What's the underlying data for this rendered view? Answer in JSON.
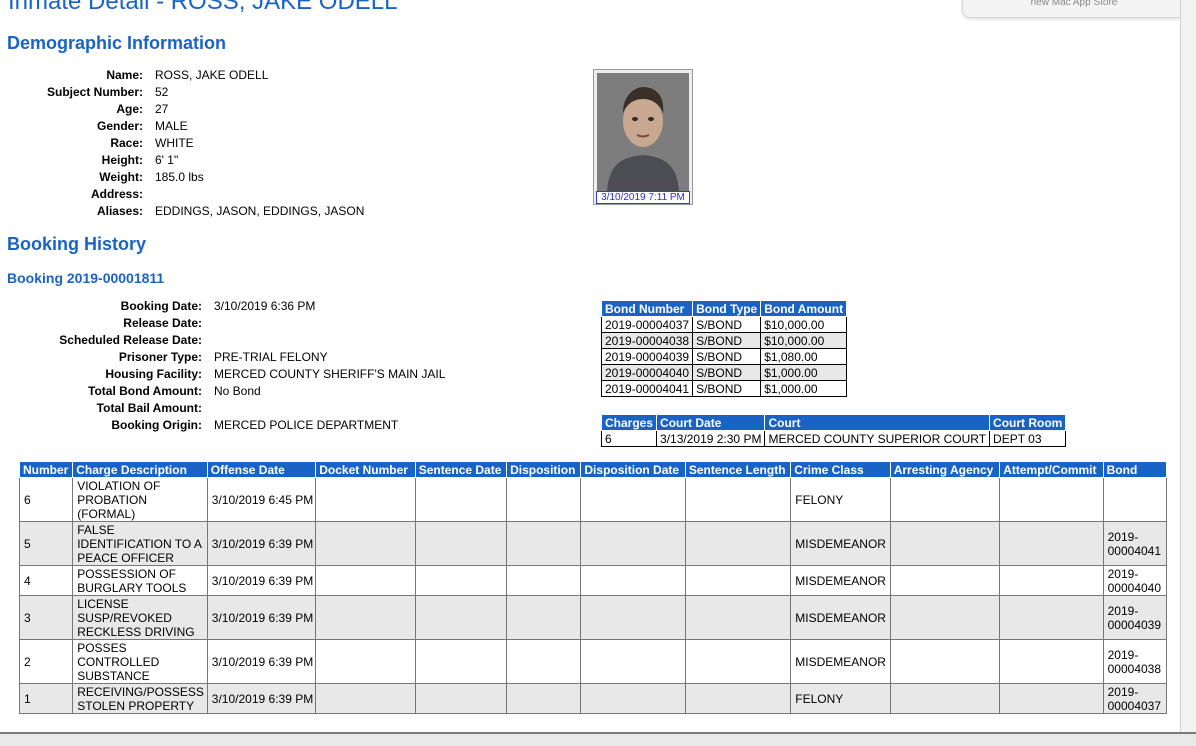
{
  "page": {
    "title": "Inmate Detail - ROSS, JAKE ODELL",
    "notification": "new Mac App Store"
  },
  "demographic": {
    "heading": "Demographic Information",
    "fields": [
      {
        "label": "Name:",
        "value": "ROSS, JAKE ODELL"
      },
      {
        "label": "Subject Number:",
        "value": "52"
      },
      {
        "label": "Age:",
        "value": "27"
      },
      {
        "label": "Gender:",
        "value": "MALE"
      },
      {
        "label": "Race:",
        "value": "WHITE"
      },
      {
        "label": "Height:",
        "value": "6' 1\""
      },
      {
        "label": "Weight:",
        "value": "185.0 lbs"
      },
      {
        "label": "Address:",
        "value": ""
      },
      {
        "label": "Aliases:",
        "value": "EDDINGS, JASON, EDDINGS, JASON"
      }
    ],
    "photo_caption": "3/10/2019 7:11 PM"
  },
  "booking_history": {
    "heading": "Booking History",
    "booking_title": "Booking 2019-00001811",
    "fields": [
      {
        "label": "Booking Date:",
        "value": "3/10/2019 6:36 PM"
      },
      {
        "label": "Release Date:",
        "value": ""
      },
      {
        "label": "Scheduled Release Date:",
        "value": ""
      },
      {
        "label": "Prisoner Type:",
        "value": "PRE-TRIAL FELONY"
      },
      {
        "label": "Housing Facility:",
        "value": "MERCED COUNTY SHERIFF'S MAIN JAIL"
      },
      {
        "label": "Total Bond Amount:",
        "value": "No Bond"
      },
      {
        "label": "Total Bail Amount:",
        "value": ""
      },
      {
        "label": "Booking Origin:",
        "value": "MERCED POLICE DEPARTMENT"
      }
    ]
  },
  "bonds": {
    "headers": [
      "Bond Number",
      "Bond Type",
      "Bond Amount"
    ],
    "rows": [
      [
        "2019-00004037",
        "S/BOND",
        "$10,000.00"
      ],
      [
        "2019-00004038",
        "S/BOND",
        "$10,000.00"
      ],
      [
        "2019-00004039",
        "S/BOND",
        "$1,080.00"
      ],
      [
        "2019-00004040",
        "S/BOND",
        "$1,000.00"
      ],
      [
        "2019-00004041",
        "S/BOND",
        "$1,000.00"
      ]
    ]
  },
  "court": {
    "headers": [
      "Charges",
      "Court Date",
      "Court",
      "Court Room"
    ],
    "rows": [
      [
        "6",
        "3/13/2019 2:30 PM",
        "MERCED COUNTY SUPERIOR COURT",
        "DEPT 03"
      ]
    ]
  },
  "charges": {
    "headers": [
      "Number",
      "Charge Description",
      "Offense Date",
      "Docket Number",
      "Sentence Date",
      "Disposition",
      "Disposition Date",
      "Sentence Length",
      "Crime Class",
      "Arresting Agency",
      "Attempt/Commit",
      "Bond"
    ],
    "rows": [
      [
        "6",
        "VIOLATION OF PROBATION (FORMAL)",
        "3/10/2019 6:45 PM",
        "",
        "",
        "",
        "",
        "",
        "FELONY",
        "",
        "",
        ""
      ],
      [
        "5",
        "FALSE IDENTIFICATION TO A PEACE OFFICER",
        "3/10/2019 6:39 PM",
        "",
        "",
        "",
        "",
        "",
        "MISDEMEANOR",
        "",
        "",
        "2019-00004041"
      ],
      [
        "4",
        "POSSESSION OF BURGLARY TOOLS",
        "3/10/2019 6:39 PM",
        "",
        "",
        "",
        "",
        "",
        "MISDEMEANOR",
        "",
        "",
        "2019-00004040"
      ],
      [
        "3",
        "LICENSE SUSP/REVOKED RECKLESS DRIVING",
        "3/10/2019 6:39 PM",
        "",
        "",
        "",
        "",
        "",
        "MISDEMEANOR",
        "",
        "",
        "2019-00004039"
      ],
      [
        "2",
        "POSSES CONTROLLED SUBSTANCE",
        "3/10/2019 6:39 PM",
        "",
        "",
        "",
        "",
        "",
        "MISDEMEANOR",
        "",
        "",
        "2019-00004038"
      ],
      [
        "1",
        "RECEIVING/POSSESS STOLEN PROPERTY",
        "3/10/2019 6:39 PM",
        "",
        "",
        "",
        "",
        "",
        "FELONY",
        "",
        "",
        "2019-00004037"
      ]
    ]
  }
}
